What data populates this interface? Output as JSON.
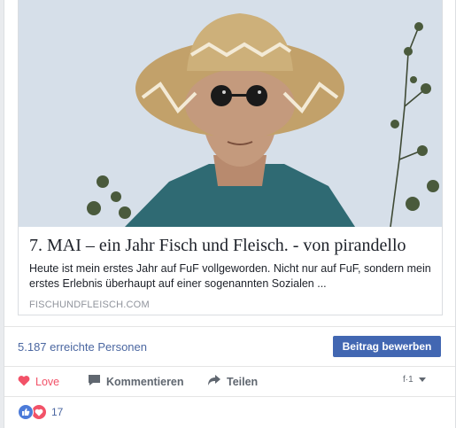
{
  "link_preview": {
    "title": "7. MAI – ein Jahr Fisch und Fleisch. - von pirandello",
    "description": "Heute ist mein erstes Jahr auf FuF vollgeworden. Nicht nur auf FuF, sondern mein erstes Erlebnis überhaupt auf einer sogenannten Sozialen ...",
    "domain": "FISCHUNDFLEISCH.COM"
  },
  "reach": {
    "text": "5.187 erreichte Personen",
    "boost_label": "Beitrag bewerben"
  },
  "actions": {
    "love_label": "Love",
    "comment_label": "Kommentieren",
    "share_label": "Teilen",
    "audience_text": "f·1"
  },
  "reactions": {
    "count": "17"
  },
  "colors": {
    "link_blue": "#4b67a1",
    "button_blue": "#4267b2",
    "love_red": "#f25268",
    "muted_gray": "#90949c"
  },
  "icons": [
    "heart-icon",
    "comment-icon",
    "share-arrow-icon",
    "like-reaction-icon",
    "love-reaction-icon",
    "dropdown-caret-icon"
  ]
}
